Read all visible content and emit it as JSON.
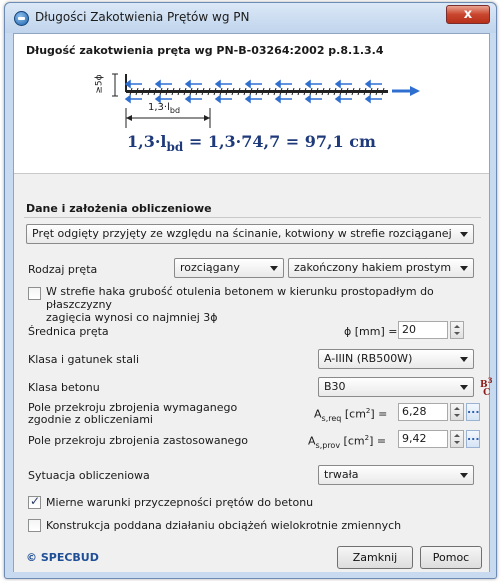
{
  "window": {
    "title": "Długości Zakotwienia Prętów wg PN",
    "close_glyph": "x"
  },
  "result": {
    "heading": "Długość zakotwienia pręta wg PN-B-03264:2002 p.8.1.3.4",
    "dim_label_main": "1,3·l",
    "dim_label_sub": "bd",
    "dim_phi": "≥5ϕ",
    "formula_left": "1,3·l",
    "formula_left_sub": "bd",
    "formula_right": " = 1,3·74,7 = 97,1 cm"
  },
  "form": {
    "section_title": "Dane i założenia obliczeniowe",
    "main_select": "Pręt odgięty przyjęty ze względu na ścinanie, kotwiony w strefie rozciąganej",
    "rodzaj_label": "Rodzaj pręta",
    "rodzaj_select1": "rozciągany",
    "rodzaj_select2": "zakończony hakiem prostym",
    "hook_check_label_line1": "W strefie haka grubość otulenia betonem w kierunku prostopadłym do płaszczyzny",
    "hook_check_label_line2": "zagięcia wynosi co najmniej 3ϕ",
    "hook_checked": false,
    "srednica_label": "Średnica pręta",
    "srednica_unit": "ϕ [mm] = ",
    "srednica_value": "20",
    "stal_label": "Klasa i gatunek stali",
    "stal_value": "A-IIIN (RB500W)",
    "beton_label": "Klasa betonu",
    "beton_value": "B30",
    "as_req_label_line1": "Pole przekroju zbrojenia wymaganego",
    "as_req_label_line2": "zgodnie z obliczeniami",
    "as_req_sym": "A",
    "as_req_sub": "s,req",
    "as_req_unit": " [cm",
    "as_req_unit_tail": "] = ",
    "as_req_value": "6,28",
    "as_prov_label": "Pole przekroju zbrojenia zastosowanego",
    "as_prov_sym": "A",
    "as_prov_sub": "s,prov",
    "as_prov_unit": " [cm",
    "as_prov_unit_tail": "] = ",
    "as_prov_value": "9,42",
    "sytuacja_label": "Sytuacja obliczeniowa",
    "sytuacja_value": "trwała",
    "check_mierne_label": "Mierne warunki przyczepności prętów do betonu",
    "check_mierne_checked": true,
    "check_konstr_label": "Konstrukcja poddana działaniu obciążeń wielokrotnie zmiennych",
    "check_konstr_checked": false,
    "dots": "...",
    "beton_icon_top": "B",
    "beton_icon_sub": "C",
    "beton_icon_num": "3"
  },
  "footer": {
    "brand": "© SPECBUD",
    "close_button": "Zamknij",
    "help_button": "Pomoc"
  },
  "colors": {
    "accent": "#2f6fd0",
    "formula": "#1f3a7a",
    "brand": "#1f4f96"
  }
}
